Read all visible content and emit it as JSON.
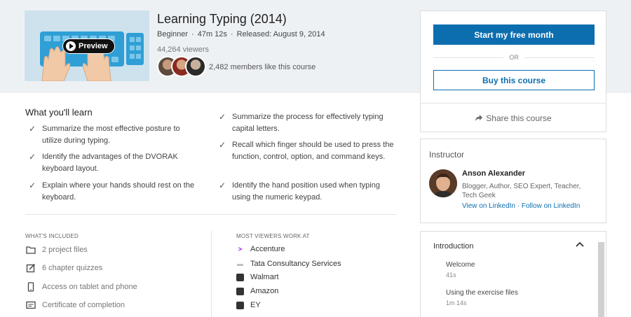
{
  "course": {
    "title": "Learning Typing (2014)",
    "level": "Beginner",
    "duration": "47m 12s",
    "released": "Released: August 9, 2014",
    "viewers": "44,264 viewers",
    "likes": "2,482 members like this course",
    "preview_label": "Preview"
  },
  "cta": {
    "primary_label": "Start my free month",
    "or_label": "OR",
    "secondary_label": "Buy this course",
    "share_label": "Share this course"
  },
  "learn": {
    "heading": "What you'll learn",
    "left": [
      "Summarize the most effective posture to utilize during typing.",
      "Identify the advantages of the DVORAK keyboard layout.",
      "Explain where your hands should rest on the keyboard."
    ],
    "right": [
      "Summarize the process for effectively typing capital letters.",
      "Recall which finger should be used to press the function, control, option, and command keys.",
      "Identify the hand position used when typing using the numeric keypad."
    ]
  },
  "included": {
    "heading": "WHAT'S INCLUDED",
    "items": [
      {
        "icon": "folder-icon",
        "label": "2 project files"
      },
      {
        "icon": "quiz-icon",
        "label": "6 chapter quizzes"
      },
      {
        "icon": "phone-icon",
        "label": "Access on tablet and phone"
      },
      {
        "icon": "certificate-icon",
        "label": "Certificate of completion"
      }
    ]
  },
  "companies": {
    "heading": "MOST VIEWERS WORK AT",
    "items": [
      {
        "logo": "accenture-logo",
        "name": "Accenture"
      },
      {
        "logo": "tcs-logo",
        "name": "Tata Consultancy Services"
      },
      {
        "logo": "walmart-logo",
        "name": "Walmart"
      },
      {
        "logo": "amazon-logo",
        "name": "Amazon"
      },
      {
        "logo": "ey-logo",
        "name": "EY"
      }
    ]
  },
  "instructor": {
    "heading": "Instructor",
    "name": "Anson Alexander",
    "bio": "Blogger, Author, SEO Expert, Teacher, Tech Geek",
    "link_linkedin": "View on LinkedIn",
    "link_sep": "·",
    "link_follow": "Follow on LinkedIn"
  },
  "toc": {
    "heading": "Introduction",
    "items": [
      {
        "title": "Welcome",
        "duration": "41s"
      },
      {
        "title": "Using the exercise files",
        "duration": "1m 14s"
      }
    ]
  },
  "colors": {
    "accent": "#0d6eaf",
    "hero_bg": "#eef1f4",
    "accenture": "#a100ff"
  }
}
